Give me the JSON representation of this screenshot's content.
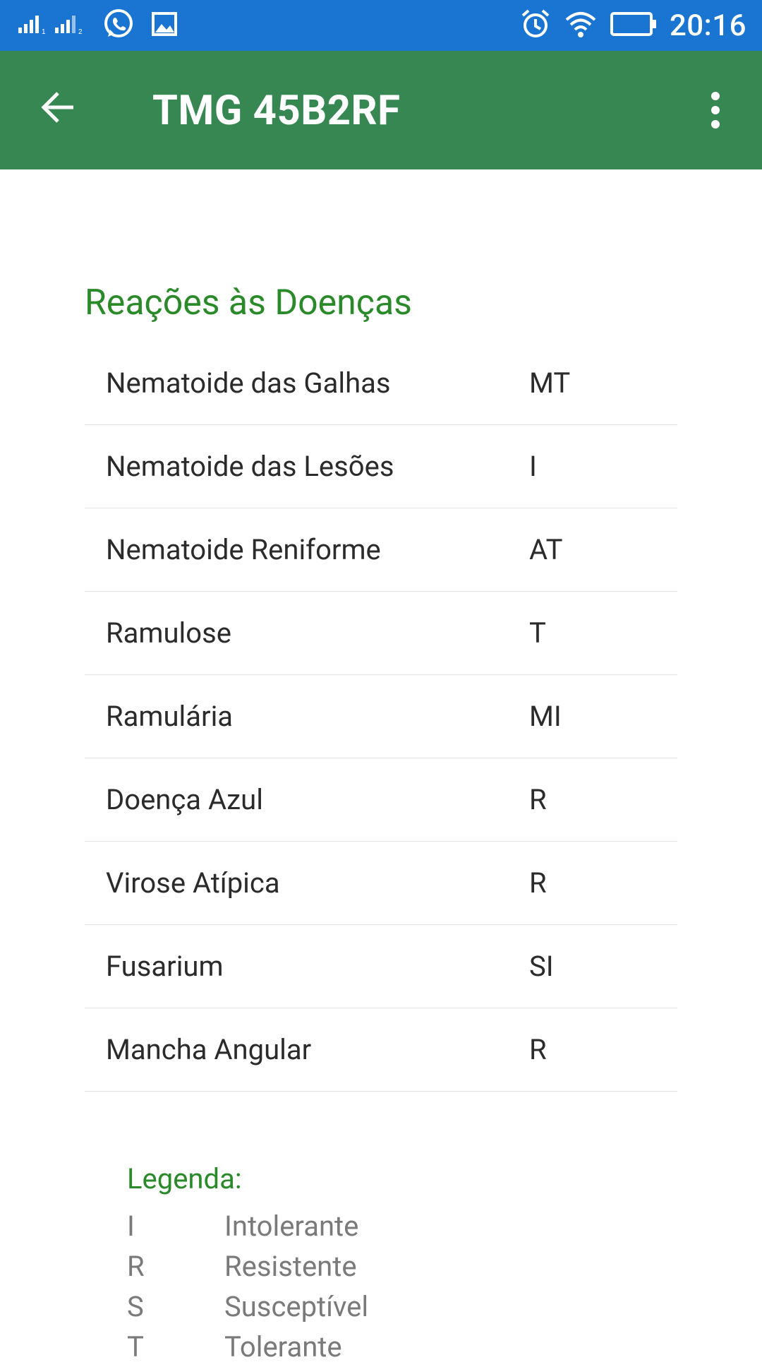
{
  "status_bar": {
    "time": "20:16",
    "icons": [
      "signal-sim1-icon",
      "signal-sim2-icon",
      "whatsapp-icon",
      "image-icon",
      "alarm-icon",
      "wifi-icon",
      "battery-icon"
    ],
    "color": "#1a75d2"
  },
  "app_bar": {
    "title": "TMG 45B2RF",
    "back_icon": "arrow-back-icon",
    "menu_icon": "more-vert-icon",
    "color": "#378752"
  },
  "section": {
    "title": "Reações às Doenças",
    "rows": [
      {
        "name": "Nematoide das Galhas",
        "value": "MT"
      },
      {
        "name": "Nematoide das Lesões",
        "value": "I"
      },
      {
        "name": "Nematoide Reniforme",
        "value": "AT"
      },
      {
        "name": "Ramulose",
        "value": "T"
      },
      {
        "name": "Ramulária",
        "value": "MI"
      },
      {
        "name": "Doença Azul",
        "value": "R"
      },
      {
        "name": "Virose Atípica",
        "value": "R"
      },
      {
        "name": "Fusarium",
        "value": "SI"
      },
      {
        "name": "Mancha Angular",
        "value": "R"
      }
    ]
  },
  "legend": {
    "title": "Legenda:",
    "items": [
      {
        "code": "I",
        "label": "Intolerante"
      },
      {
        "code": "R",
        "label": "Resistente"
      },
      {
        "code": "S",
        "label": "Susceptível"
      },
      {
        "code": "T",
        "label": "Tolerante"
      }
    ]
  },
  "colors": {
    "accent_green": "#2a8a2a",
    "text": "#2b2b2b",
    "legend_text": "#7a7a7a"
  }
}
